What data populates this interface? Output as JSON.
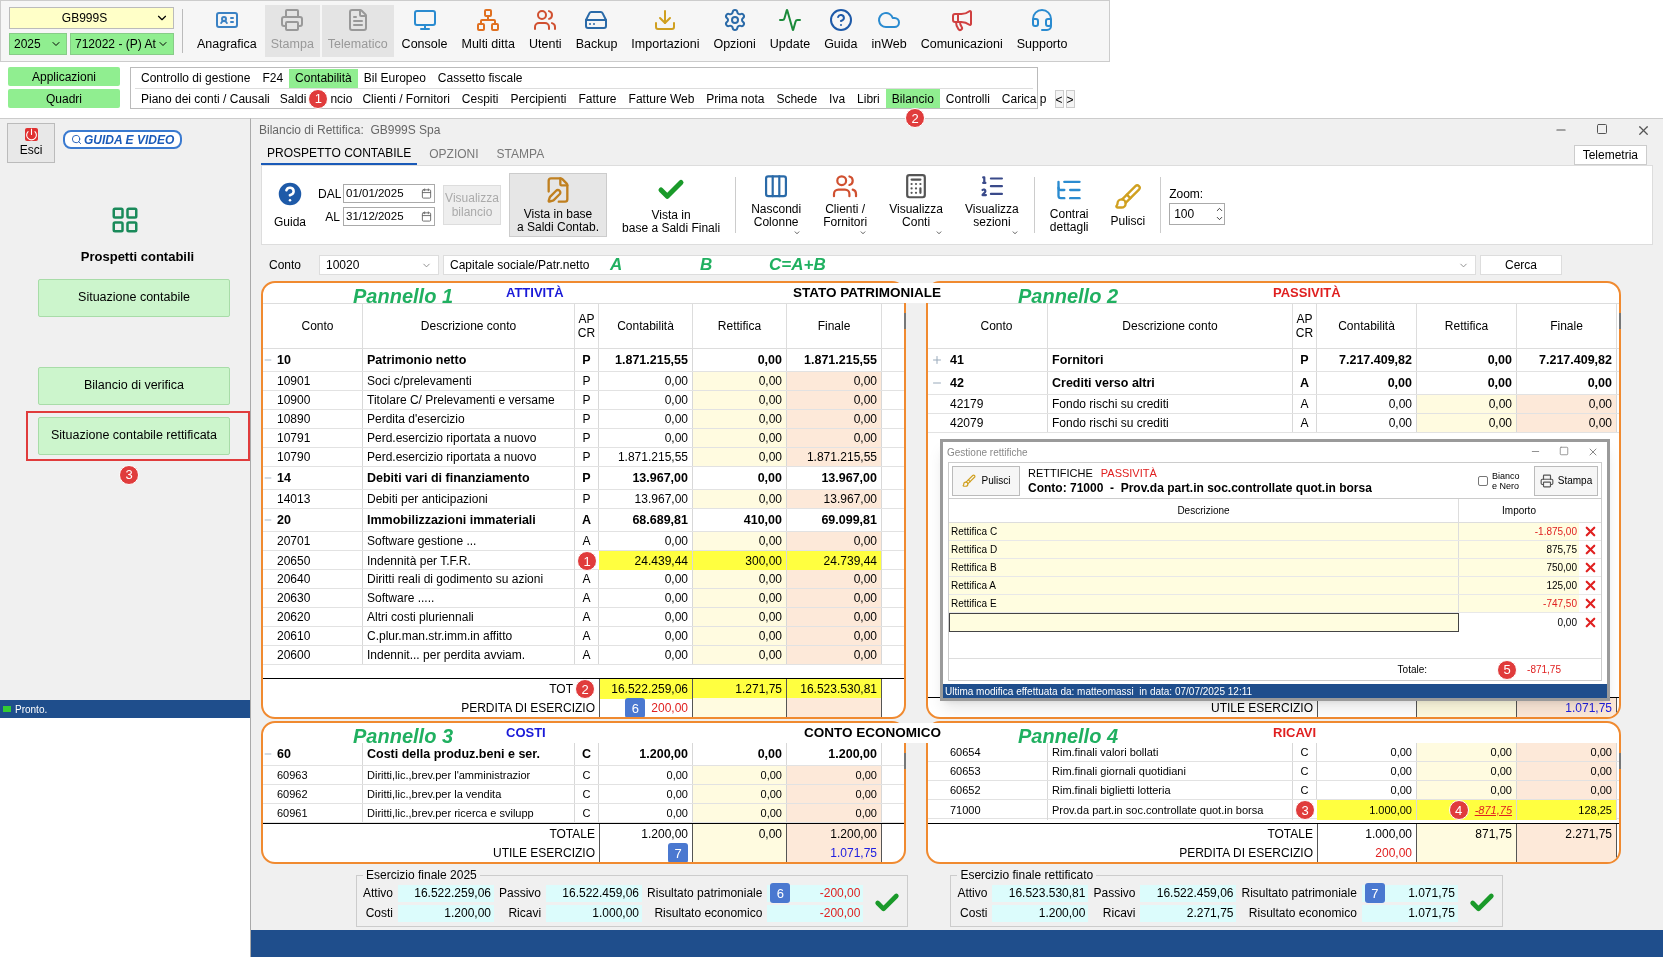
{
  "top": {
    "company": "GB999S",
    "year": "2025",
    "firm": "712022 - (P) At",
    "tools": [
      {
        "label": "Anagrafica",
        "disabled": false
      },
      {
        "label": "Stampa",
        "disabled": true
      },
      {
        "label": "Telematico",
        "disabled": true
      },
      {
        "label": "Console",
        "disabled": false
      },
      {
        "label": "Multi ditta",
        "disabled": false
      },
      {
        "label": "Utenti",
        "disabled": false
      },
      {
        "label": "Backup",
        "disabled": false
      },
      {
        "label": "Importazioni",
        "disabled": false
      },
      {
        "label": "Opzioni",
        "disabled": false
      },
      {
        "label": "Update",
        "disabled": false
      },
      {
        "label": "Guida",
        "disabled": false
      },
      {
        "label": "inWeb",
        "disabled": false
      },
      {
        "label": "Comunicazioni",
        "disabled": false
      },
      {
        "label": "Supporto",
        "disabled": false
      }
    ],
    "side_buttons": [
      "Applicazioni",
      "Quadri"
    ],
    "menu_1": [
      {
        "label": "Controllo di gestione",
        "selected": false
      },
      {
        "label": "F24",
        "selected": false
      },
      {
        "label": "Contabilità",
        "selected": true
      },
      {
        "label": "Bil Europeo",
        "selected": false
      },
      {
        "label": "Cassetto fiscale",
        "selected": false
      }
    ],
    "menu_2": [
      {
        "label": "Piano dei conti / Causali",
        "selected": false
      },
      {
        "label": "Saldi",
        "badge": {
          "text": "1",
          "kind": "circle"
        },
        "label_after": "ncio",
        "selected": false
      },
      {
        "label": "Clienti / Fornitori",
        "selected": false
      },
      {
        "label": "Cespiti",
        "selected": false
      },
      {
        "label": "Percipienti",
        "selected": false
      },
      {
        "label": "Fatture",
        "selected": false
      },
      {
        "label": "Fatture Web",
        "selected": false
      },
      {
        "label": "Prima nota",
        "selected": false
      },
      {
        "label": "Schede",
        "selected": false
      },
      {
        "label": "Iva",
        "selected": false
      },
      {
        "label": "Libri",
        "selected": false
      },
      {
        "label": "Bilancio",
        "selected": true
      },
      {
        "label": "Controlli",
        "selected": false
      },
      {
        "label": "Carica p",
        "selected": false
      }
    ],
    "nav": [
      "<",
      ">"
    ],
    "menu_badge": {
      "text": "2",
      "kind": "circle"
    }
  },
  "sidebar": {
    "exit": "Esci",
    "guide": "GUIDA E VIDEO",
    "title": "Prospetti contabili",
    "buttons": [
      {
        "label": "Situazione contabile",
        "selected": false
      },
      {
        "label": "Bilancio di verifica",
        "selected": false
      },
      {
        "label": "Situazione contabile rettificata",
        "selected": true,
        "badge": {
          "text": "3",
          "kind": "circle"
        }
      }
    ],
    "status": "Pronto."
  },
  "window": {
    "title": "Bilancio di Rettifica:  GB999S Spa",
    "tabs": [
      {
        "label": "PROSPETTO CONTABILE",
        "selected": true
      },
      {
        "label": "OPZIONI",
        "selected": false
      },
      {
        "label": "STAMPA",
        "selected": false
      }
    ],
    "telemetry": "Telemetria",
    "toolbar": {
      "guide": "Guida",
      "from_label": "DAL",
      "from": "01/01/2025",
      "to_label": "AL",
      "to": "31/12/2025",
      "show_balance": "Visualizza bilancio",
      "buttons": [
        {
          "lines": [
            "Vista in base",
            "a Saldi Contab."
          ],
          "selected": true,
          "dropdown": false
        },
        {
          "lines": [
            "Vista in",
            "base a Saldi Finali"
          ],
          "selected": false,
          "dropdown": false
        },
        {
          "lines": [
            "Nascondi",
            "Colonne"
          ],
          "selected": false,
          "dropdown": true
        },
        {
          "lines": [
            "Clienti /",
            "Fornitori"
          ],
          "selected": false,
          "dropdown": true
        },
        {
          "lines": [
            "Visualizza",
            "Conti"
          ],
          "selected": false,
          "dropdown": true
        },
        {
          "lines": [
            "Visualizza",
            "sezioni"
          ],
          "selected": false,
          "dropdown": true
        },
        {
          "lines": [
            "Contrai",
            "dettagli"
          ],
          "selected": false,
          "dropdown": false
        },
        {
          "lines": [
            "Pulisci"
          ],
          "selected": false,
          "dropdown": false
        }
      ],
      "zoom_label": "Zoom:",
      "zoom": "100"
    },
    "account": {
      "label": "Conto",
      "code": "10020",
      "description": "Capitale sociale/Patr.netto",
      "search": "Cerca",
      "notes": [
        "A",
        "B",
        "C=A+B"
      ]
    },
    "sections": [
      {
        "title": "STATO PATRIMONIALE",
        "panels": [
          {
            "label": "Pannello 1",
            "heading": "ATTIVITÀ",
            "liability": false,
            "columns": [
              "Conto",
              "Descrizione conto",
              "AP CR",
              "Contabilità",
              "Rettifica",
              "Finale"
            ],
            "rows": [
              {
                "kind": "group",
                "expanded": true,
                "conto": "10",
                "descrizione": "Patrimonio netto",
                "apcr": "P",
                "contabilita": "1.871.215,55",
                "rettifica": "0,00",
                "finale": "1.871.215,55"
              },
              {
                "kind": "item",
                "conto": "10901",
                "descrizione": "Soci c/prelevamenti",
                "apcr": "P",
                "contabilita": "0,00",
                "rettifica": "0,00",
                "finale": "0,00"
              },
              {
                "kind": "item",
                "conto": "10900",
                "descrizione": "Titolare C/ Prelevamenti e versame",
                "apcr": "P",
                "contabilita": "0,00",
                "rettifica": "0,00",
                "finale": "0,00"
              },
              {
                "kind": "item",
                "conto": "10890",
                "descrizione": "Perdita d'esercizio",
                "apcr": "P",
                "contabilita": "0,00",
                "rettifica": "0,00",
                "finale": "0,00"
              },
              {
                "kind": "item",
                "conto": "10791",
                "descrizione": "Perd.esercizio riportata a nuovo",
                "apcr": "P",
                "contabilita": "0,00",
                "rettifica": "0,00",
                "finale": "0,00"
              },
              {
                "kind": "item",
                "conto": "10790",
                "descrizione": "Perd.esercizio riportata a nuovo",
                "apcr": "P",
                "contabilita": "1.871.215,55",
                "rettifica": "0,00",
                "finale": "1.871.215,55"
              },
              {
                "kind": "group",
                "expanded": true,
                "conto": "14",
                "descrizione": "Debiti vari di finanziamento",
                "apcr": "P",
                "contabilita": "13.967,00",
                "rettifica": "0,00",
                "finale": "13.967,00"
              },
              {
                "kind": "item",
                "conto": "14013",
                "descrizione": "Debiti per anticipazioni",
                "apcr": "P",
                "contabilita": "13.967,00",
                "rettifica": "0,00",
                "finale": "13.967,00"
              },
              {
                "kind": "group",
                "expanded": true,
                "conto": "20",
                "descrizione": "Immobilizzazioni immateriali",
                "apcr": "A",
                "contabilita": "68.689,81",
                "rettifica": "410,00",
                "finale": "69.099,81"
              },
              {
                "kind": "item",
                "conto": "20701",
                "descrizione": "Software gestione ...",
                "apcr": "A",
                "contabilita": "0,00",
                "rettifica": "0,00",
                "finale": "0,00"
              },
              {
                "kind": "item",
                "conto": "20650",
                "descrizione": "Indennità per T.F.R.",
                "badge": {
                  "text": "1",
                  "kind": "circle"
                },
                "contabilita": "24.439,44",
                "rettifica": "300,00",
                "finale": "24.739,44",
                "highlight": true
              },
              {
                "kind": "item",
                "conto": "20640",
                "descrizione": "Diritti reali di godimento su azioni",
                "apcr": "A",
                "contabilita": "0,00",
                "rettifica": "0,00",
                "finale": "0,00"
              },
              {
                "kind": "item",
                "conto": "20630",
                "descrizione": "Software .....",
                "apcr": "A",
                "contabilita": "0,00",
                "rettifica": "0,00",
                "finale": "0,00"
              },
              {
                "kind": "item",
                "conto": "20620",
                "descrizione": "Altri costi pluriennali",
                "apcr": "A",
                "contabilita": "0,00",
                "rettifica": "0,00",
                "finale": "0,00"
              },
              {
                "kind": "item",
                "conto": "20610",
                "descrizione": "C.plur.man.str.imm.in affitto",
                "apcr": "A",
                "contabilita": "0,00",
                "rettifica": "0,00",
                "finale": "0,00"
              },
              {
                "kind": "item",
                "conto": "20600",
                "descrizione": "Indennit... per perdita avviam.",
                "apcr": "A",
                "contabilita": "0,00",
                "rettifica": "0,00",
                "finale": "0,00"
              }
            ],
            "footer": [
              {
                "kind": "total",
                "label": "TOT",
                "badge": {
                  "text": "2",
                  "kind": "circle"
                },
                "contabilita": "16.522.259,06",
                "rettifica": "1.271,75",
                "finale": "16.523.530,81",
                "highlight": true
              },
              {
                "kind": "result",
                "label": "PERDITA DI ESERCIZIO",
                "badge": {
                  "text": "6",
                  "kind": "square"
                },
                "contabilita": "200,00",
                "negative": true
              }
            ]
          },
          {
            "label": "Pannello 2",
            "heading": "PASSIVITÀ",
            "liability": true,
            "columns": [
              "Conto",
              "Descrizione conto",
              "AP CR",
              "Contabilità",
              "Rettifica",
              "Finale"
            ],
            "rows": [
              {
                "kind": "group",
                "expanded": false,
                "conto": "41",
                "descrizione": "Fornitori",
                "apcr": "P",
                "contabilita": "7.217.409,82",
                "rettifica": "0,00",
                "finale": "7.217.409,82"
              },
              {
                "kind": "group",
                "expanded": true,
                "conto": "42",
                "descrizione": "Crediti verso altri",
                "apcr": "A",
                "contabilita": "0,00",
                "rettifica": "0,00",
                "finale": "0,00"
              },
              {
                "kind": "item",
                "conto": "42179",
                "descrizione": "Fondo rischi su crediti",
                "apcr": "A",
                "contabilita": "0,00",
                "rettifica": "0,00",
                "finale": "0,00"
              },
              {
                "kind": "item",
                "conto": "42079",
                "descrizione": "Fondo rischi su crediti",
                "apcr": "A",
                "contabilita": "0,00",
                "rettifica": "0,00",
                "finale": "0,00"
              }
            ],
            "footer": [
              {
                "kind": "result",
                "label": "UTILE ESERCIZIO",
                "finale": "1.071,75",
                "positive": true
              }
            ],
            "dialog": {
              "title": "Gestione rettifiche",
              "clear": "Pulisci",
              "heading": "RETTIFICHE",
              "side": "PASSIVITÀ",
              "account": "Conto: 71000  -  Prov.da part.in soc.controllate quot.in borsa",
              "bw": {
                "label": "Bianco e Nero",
                "checked": false
              },
              "print": "Stampa",
              "columns": [
                "Descrizione",
                "Importo"
              ],
              "rows": [
                {
                  "descrizione": "Rettifica C",
                  "importo": "-1.875,00",
                  "negative": true
                },
                {
                  "descrizione": "Rettifica D",
                  "importo": "875,75",
                  "negative": false
                },
                {
                  "descrizione": "Rettifica B",
                  "importo": "750,00",
                  "negative": false
                },
                {
                  "descrizione": "Rettifica A",
                  "importo": "125,00",
                  "negative": false
                },
                {
                  "descrizione": "Rettifica E",
                  "importo": "-747,50",
                  "negative": true
                }
              ],
              "new_row": "0,00",
              "total_label": "Totale:",
              "total": "-871,75",
              "badge": {
                "text": "5",
                "kind": "circle"
              },
              "status": "Ultima modifica effettuata da: matteomassi  in data: 07/07/2025 12:11"
            }
          }
        ]
      },
      {
        "title": "CONTO ECONOMICO",
        "panels": [
          {
            "label": "Pannello 3",
            "heading": "COSTI",
            "liability": false,
            "rows": [
              {
                "kind": "group",
                "expanded": true,
                "conto": "60",
                "descrizione": "Costi della produz.beni e ser.",
                "apcr": "C",
                "contabilita": "1.200,00",
                "rettifica": "0,00",
                "finale": "1.200,00"
              },
              {
                "kind": "item",
                "conto": "60963",
                "descrizione": "Diritti,lic.,brev.per l'amministrazior",
                "apcr": "C",
                "contabilita": "0,00",
                "rettifica": "0,00",
                "finale": "0,00"
              },
              {
                "kind": "item",
                "conto": "60962",
                "descrizione": "Diritti,lic.,brev.per la vendita",
                "apcr": "C",
                "contabilita": "0,00",
                "rettifica": "0,00",
                "finale": "0,00"
              },
              {
                "kind": "item",
                "conto": "60961",
                "descrizione": "Diritti,lic.,brev.per ricerca e svilupp",
                "apcr": "C",
                "contabilita": "0,00",
                "rettifica": "0,00",
                "finale": "0,00"
              }
            ],
            "footer": [
              {
                "kind": "total",
                "label": "TOTALE",
                "contabilita": "1.200,00",
                "rettifica": "0,00",
                "finale": "1.200,00"
              },
              {
                "kind": "result",
                "label": "UTILE ESERCIZIO",
                "badge": {
                  "text": "7",
                  "kind": "square"
                },
                "finale": "1.071,75",
                "positive": true
              }
            ]
          },
          {
            "label": "Pannello 4",
            "heading": "RICAVI",
            "liability": true,
            "rows": [
              {
                "kind": "item",
                "conto": "60654",
                "descrizione": "Rim.finali valori bollati",
                "apcr": "C",
                "contabilita": "0,00",
                "rettifica": "0,00",
                "finale": "0,00"
              },
              {
                "kind": "item",
                "conto": "60653",
                "descrizione": "Rim.finali giornali quotidiani",
                "apcr": "C",
                "contabilita": "0,00",
                "rettifica": "0,00",
                "finale": "0,00"
              },
              {
                "kind": "item",
                "conto": "60652",
                "descrizione": "Rim.finali biglietti lotteria",
                "apcr": "C",
                "contabilita": "0,00",
                "rettifica": "0,00",
                "finale": "0,00"
              },
              {
                "kind": "item",
                "conto": "71000",
                "descrizione": "Prov.da part.in soc.controllate quot.in borsa",
                "badge": {
                  "text": "3",
                  "kind": "circle"
                },
                "contabilita": "1.000,00",
                "rettifica": "-871,75",
                "rettifica_badge": {
                  "text": "4",
                  "kind": "circle"
                },
                "adjusted": true,
                "finale": "128,25",
                "highlight": true
              }
            ],
            "footer": [
              {
                "kind": "total",
                "label": "TOTALE",
                "contabilita": "1.000,00",
                "rettifica": "871,75",
                "finale": "2.271,75"
              },
              {
                "kind": "result",
                "label": "PERDITA DI ESERCIZIO",
                "contabilita": "200,00",
                "negative": true
              }
            ]
          }
        ]
      }
    ],
    "summary": [
      {
        "title": "Esercizio finale 2025",
        "badge": {
          "text": "6",
          "kind": "square"
        },
        "balanced": true,
        "fields": [
          {
            "label": "Attivo",
            "value": "16.522.259,06",
            "negative": false
          },
          {
            "label": "Passivo",
            "value": "16.522.459,06",
            "negative": false
          },
          {
            "label": "Risultato patrimoniale",
            "value": "-200,00",
            "negative": true
          },
          {
            "label": "Costi",
            "value": "1.200,00",
            "negative": false
          },
          {
            "label": "Ricavi",
            "value": "1.000,00",
            "negative": false
          },
          {
            "label": "Risultato economico",
            "value": "-200,00",
            "negative": true
          }
        ]
      },
      {
        "title": "Esercizio finale rettificato",
        "badge": {
          "text": "7",
          "kind": "square"
        },
        "balanced": true,
        "fields": [
          {
            "label": "Attivo",
            "value": "16.523.530,81",
            "negative": false
          },
          {
            "label": "Passivo",
            "value": "16.522.459,06",
            "negative": false
          },
          {
            "label": "Risultato patrimoniale",
            "value": "1.071,75",
            "negative": false
          },
          {
            "label": "Costi",
            "value": "1.200,00",
            "negative": false
          },
          {
            "label": "Ricavi",
            "value": "2.271,75",
            "negative": false
          },
          {
            "label": "Risultato economico",
            "value": "1.071,75",
            "negative": false
          }
        ]
      }
    ]
  }
}
